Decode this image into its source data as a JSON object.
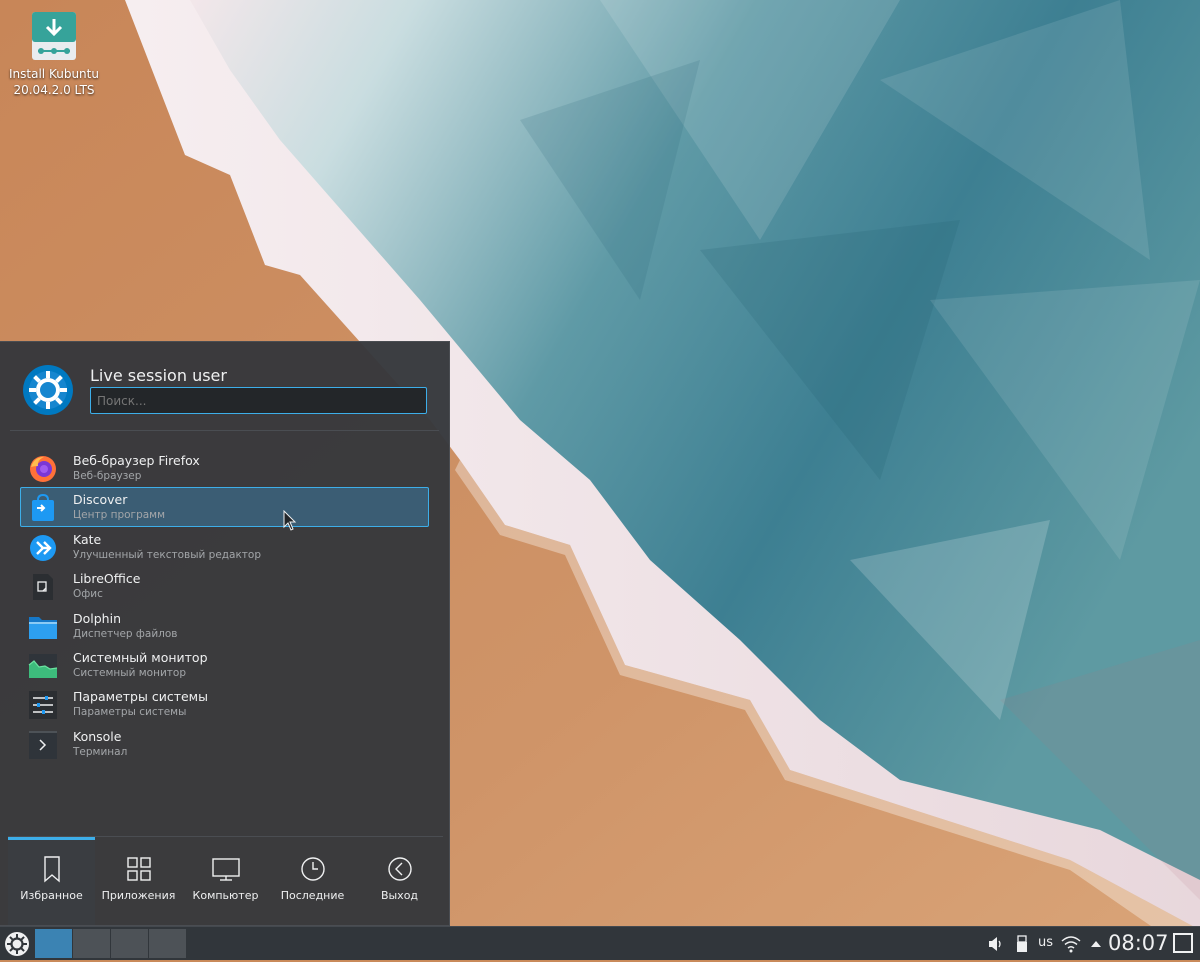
{
  "desktop": {
    "install_icon": {
      "label": "Install Kubuntu\n20.04.2.0 LTS",
      "icon": "download-install-icon"
    }
  },
  "launcher": {
    "user_name": "Live session user",
    "search_placeholder": "Поиск...",
    "apps": [
      {
        "name": "Веб-браузер Firefox",
        "desc": "Веб-браузер",
        "icon": "firefox-icon"
      },
      {
        "name": "Discover",
        "desc": "Центр программ",
        "icon": "discover-icon",
        "active": true
      },
      {
        "name": "Kate",
        "desc": "Улучшенный текстовый редактор",
        "icon": "kate-icon"
      },
      {
        "name": "LibreOffice",
        "desc": "Офис",
        "icon": "libreoffice-icon"
      },
      {
        "name": "Dolphin",
        "desc": "Диспетчер файлов",
        "icon": "dolphin-folder-icon"
      },
      {
        "name": "Системный монитор",
        "desc": "Системный монитор",
        "icon": "system-monitor-icon"
      },
      {
        "name": "Параметры системы",
        "desc": "Параметры системы",
        "icon": "system-settings-icon"
      },
      {
        "name": "Konsole",
        "desc": "Терминал",
        "icon": "konsole-icon"
      }
    ],
    "tabs": [
      {
        "label": "Избранное",
        "icon": "bookmark-icon",
        "active": true
      },
      {
        "label": "Приложения",
        "icon": "applications-grid-icon"
      },
      {
        "label": "Компьютер",
        "icon": "computer-icon"
      },
      {
        "label": "Последние",
        "icon": "clock-icon"
      },
      {
        "label": "Выход",
        "icon": "leave-icon"
      }
    ]
  },
  "taskbar": {
    "keyboard_layout": "us",
    "clock": "08:07",
    "active_desktop": 1,
    "desktop_count": 4
  },
  "colors": {
    "accent": "#3daee9",
    "panel_bg": "#31363b",
    "menu_bg": "#36383c"
  }
}
